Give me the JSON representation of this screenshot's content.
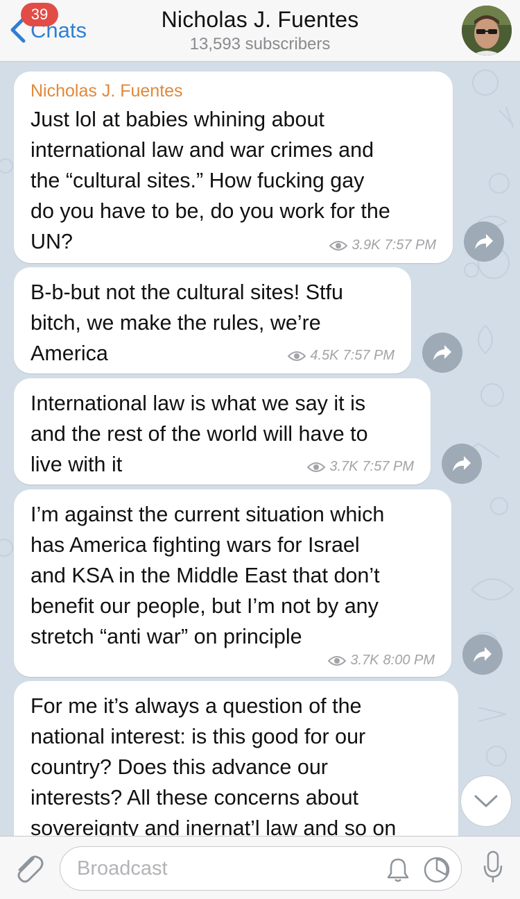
{
  "header": {
    "back_label": "Chats",
    "unread_badge": "39",
    "title": "Nicholas J. Fuentes",
    "subtitle": "13,593 subscribers"
  },
  "messages": [
    {
      "sender": "Nicholas J. Fuentes",
      "text": "Just lol at babies whining about\ninternational law and war crimes and\nthe “cultural sites.” How fucking gay\ndo you have to be, do you work for the\nUN?",
      "views": "3.9K",
      "time": "7:57 PM"
    },
    {
      "text": "B-b-but not the cultural sites! Stfu\nbitch, we make the rules, we’re\nAmerica",
      "views": "4.5K",
      "time": "7:57 PM"
    },
    {
      "text": "International law is what we say it is\nand the rest of the world will have to\nlive with it",
      "views": "3.7K",
      "time": "7:57 PM"
    },
    {
      "text": "I’m against the current situation which\nhas America fighting wars for Israel\nand KSA in the Middle East that don’t\nbenefit our people, but I’m not by any\nstretch “anti war” on principle",
      "views": "3.7K",
      "time": "8:00 PM"
    },
    {
      "text": "For me it’s always a question of the\nnational interest: is this good for our\ncountry? Does this advance our\ninterests? All these concerns about\nsovereignty and inernat’l law and so on"
    }
  ],
  "input": {
    "placeholder": "Broadcast"
  },
  "colors": {
    "accent": "#2f7fd2",
    "sender_name": "#e0883a",
    "badge": "#e24c46",
    "chat_background": "#d2dde7"
  }
}
